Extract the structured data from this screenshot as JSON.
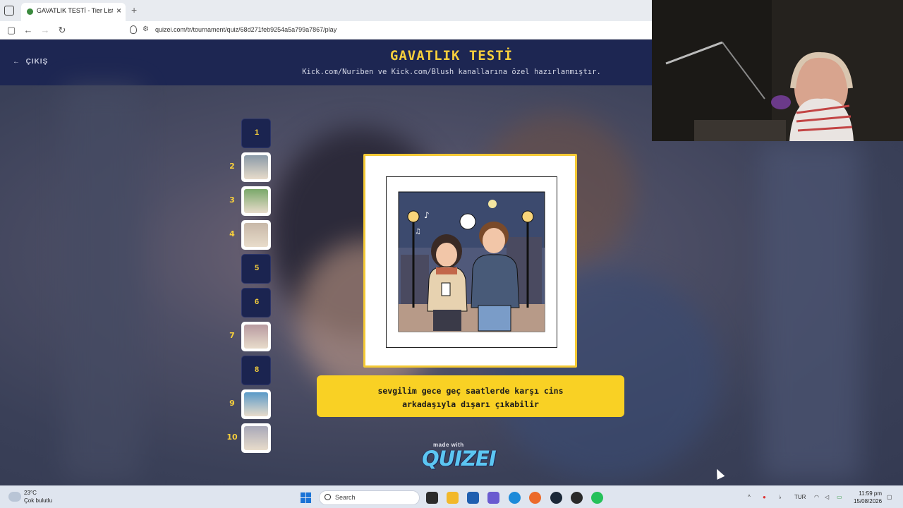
{
  "browser": {
    "tab_title": "GAVATLIK TESTİ - Tier List, Kar",
    "url": "quizei.com/tr/tournament/quiz/68d271feb9254a5a799a7867/play"
  },
  "header": {
    "exit_label": "ÇIKIŞ",
    "title": "GAVATLIK TESTİ",
    "subtitle": "Kick.com/Nuriben ve Kick.com/Blush kanallarına özel hazırlanmıştır."
  },
  "ranks": [
    {
      "label": "1",
      "filled": false
    },
    {
      "label": "2",
      "filled": true
    },
    {
      "label": "3",
      "filled": true
    },
    {
      "label": "4",
      "filled": true
    },
    {
      "label": "5",
      "filled": false
    },
    {
      "label": "6",
      "filled": false
    },
    {
      "label": "7",
      "filled": true
    },
    {
      "label": "8",
      "filled": false
    },
    {
      "label": "9",
      "filled": true
    },
    {
      "label": "10",
      "filled": true
    }
  ],
  "question": {
    "line1": "sevgilim gece geç saatlerde karşı cins",
    "line2": "arkadaşıyla dışarı çıkabilir"
  },
  "footer": {
    "made_with": "made with",
    "logo": "QUIZEI"
  },
  "taskbar": {
    "temperature": "23°C",
    "weather": "Çok bulutlu",
    "search_placeholder": "Search",
    "language": "TUR",
    "time": "11:59 pm",
    "date": "15/08/2026"
  },
  "colors": {
    "accent_yellow": "#f9d124",
    "header_navy": "#1d2652",
    "logo_blue": "#5cc6f2"
  }
}
